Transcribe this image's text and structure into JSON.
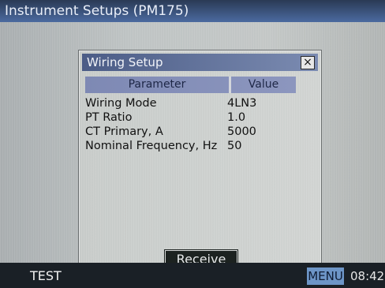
{
  "window": {
    "title": "Instrument Setups (PM175)"
  },
  "dialog": {
    "title": "Wiring Setup",
    "close_symbol": "×",
    "headers": {
      "parameter": "Parameter",
      "value": "Value"
    },
    "rows": [
      {
        "parameter": "Wiring Mode",
        "value": "4LN3"
      },
      {
        "parameter": "PT Ratio",
        "value": "1.0"
      },
      {
        "parameter": "CT Primary, A",
        "value": "5000"
      },
      {
        "parameter": "Nominal Frequency, Hz",
        "value": "50"
      }
    ],
    "receive_label": "Receive"
  },
  "statusbar": {
    "status": "TEST",
    "menu_label": "MENU",
    "time": "08:42"
  },
  "colors": {
    "title_bar": "#4b6aa0",
    "dialog_title": "#4b5c86",
    "table_header": "#7e89b4",
    "menu_button": "#6d95c7"
  },
  "icons": {
    "close": "close-icon"
  }
}
